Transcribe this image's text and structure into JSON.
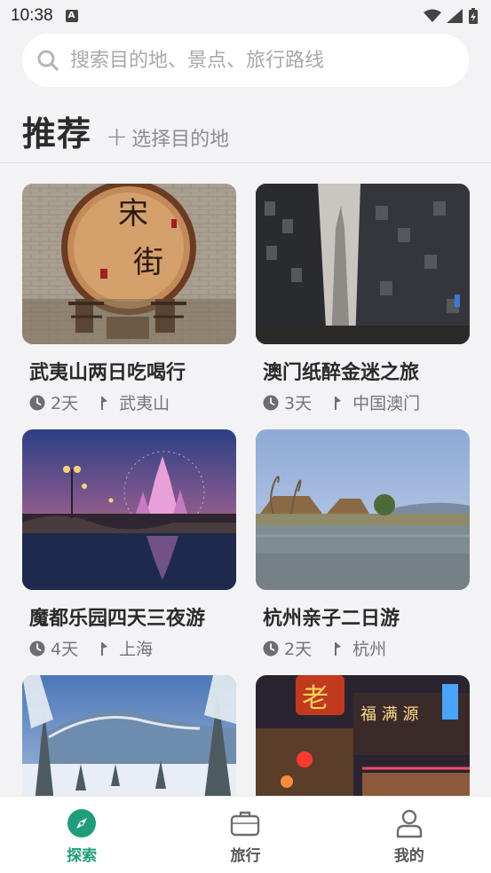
{
  "status": {
    "time": "10:38",
    "notif_letter": "A"
  },
  "search": {
    "placeholder": "搜索目的地、景点、旅行路线"
  },
  "section": {
    "title": "推荐",
    "choose_label": "选择目的地"
  },
  "cards": [
    {
      "title": "武夷山两日吃喝行",
      "days": "2天",
      "place": "武夷山"
    },
    {
      "title": "澳门纸醉金迷之旅",
      "days": "3天",
      "place": "中国澳门"
    },
    {
      "title": "魔都乐园四天三夜游",
      "days": "4天",
      "place": "上海"
    },
    {
      "title": "杭州亲子二日游",
      "days": "2天",
      "place": "杭州"
    },
    {
      "title": "",
      "days": "",
      "place": ""
    },
    {
      "title": "",
      "days": "",
      "place": ""
    }
  ],
  "card_images": {
    "img1_sign": "宋\n街"
  },
  "tabs": [
    {
      "label": "探索",
      "icon": "compass-icon",
      "active": true
    },
    {
      "label": "旅行",
      "icon": "suitcase-icon",
      "active": false
    },
    {
      "label": "我的",
      "icon": "person-icon",
      "active": false
    }
  ],
  "colors": {
    "accent": "#1f9d7a",
    "background": "#f3f3f5"
  }
}
